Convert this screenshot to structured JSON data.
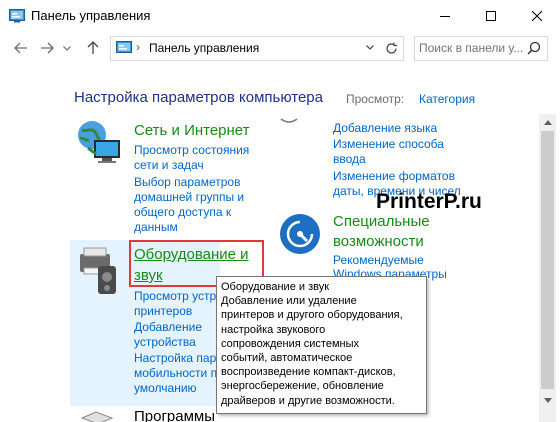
{
  "window": {
    "title": "Панель управления",
    "controls": {
      "minimize": "minimize-icon",
      "maximize": "maximize-icon",
      "close": "close-icon"
    }
  },
  "toolbar": {
    "back": "back-arrow-icon",
    "forward": "forward-arrow-icon",
    "recent": "chevron-down-icon",
    "up": "up-arrow-icon",
    "breadcrumb": "Панель управления",
    "breadcrumb_separator": "›",
    "search_placeholder": "Поиск в панели у..."
  },
  "header": {
    "title": "Настройка параметров компьютера",
    "view_by_label": "Просмотр:",
    "view_by_value": "Категория"
  },
  "categories": [
    {
      "title": "Сеть и Интернет",
      "links": [
        "Просмотр состояния",
        "сети и задач",
        "Выбор параметров",
        "домашней группы и",
        "общего доступа к",
        "данным"
      ]
    },
    {
      "title_lines": [
        "Оборудование и",
        "звук"
      ],
      "links": [
        "Просмотр устр",
        "принтеров",
        "Добавление",
        "устройства",
        "Настройка пар",
        "мобильности п",
        "умолчанию"
      ]
    },
    {
      "title": "Программы"
    },
    {
      "links": [
        "Добавление языка",
        "Изменение способа",
        "ввода",
        "Изменение форматов",
        "даты, времени и чисел"
      ]
    },
    {
      "title_lines": [
        "Специальные",
        "возможности"
      ],
      "links": [
        "Рекомендуемые",
        "Windows параметры"
      ]
    }
  ],
  "tooltip": {
    "lines": [
      "Оборудование и звук",
      "Добавление или удаление",
      "принтеров и другого оборудования,",
      "настройка звукового",
      "сопровождения системных",
      "событий, автоматическое",
      "воспроизведение компакт-дисков,",
      "энергосбережение, обновление",
      "драйверов и другие возможности."
    ]
  },
  "watermark": "PrinterP.ru",
  "colors": {
    "category_title": "#178a17",
    "link": "#0066cc",
    "heading": "#1e3287",
    "highlight_border": "#e23838",
    "hover_background": "#e5f3ff"
  }
}
